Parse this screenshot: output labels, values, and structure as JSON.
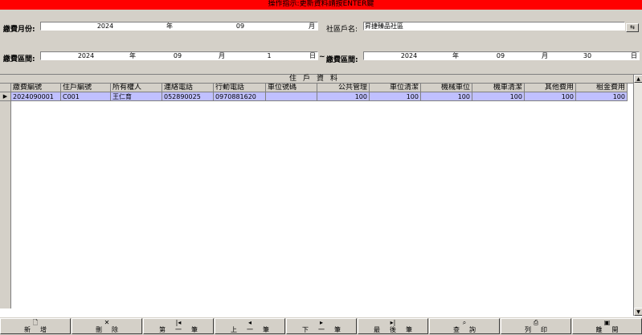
{
  "banner": "操作指示:更新資料請按ENTER鍵",
  "header": {
    "month_label": "繳費月份:",
    "month": {
      "year": "2024",
      "year_unit": "年",
      "month": "09",
      "month_unit": "月"
    },
    "community_label": "社區戶名:",
    "community_value": "昇捷臻品社區",
    "range_label": "繳費區間:",
    "range_start": {
      "year": "2024",
      "year_unit": "年",
      "month": "09",
      "month_unit": "月",
      "day": "1",
      "day_unit": "日"
    },
    "range_sep": "~",
    "range_label2": "繳費區間:",
    "range_end": {
      "year": "2024",
      "year_unit": "年",
      "month": "09",
      "month_unit": "月",
      "day": "30",
      "day_unit": "日"
    }
  },
  "grid": {
    "title": "住戶資料",
    "columns": [
      "繳費編號",
      "住戶編號",
      "所有權人",
      "連絡電話",
      "行動電話",
      "車位號碼",
      "公共管理",
      "車位清潔",
      "機械車位",
      "機車清潔",
      "其他費用",
      "租金費用"
    ],
    "rows": [
      [
        "2024090001",
        "C001",
        "王仁育",
        "052890025",
        "0970881620",
        "",
        "100",
        "100",
        "100",
        "100",
        "100",
        "100"
      ]
    ],
    "current_row_marker": "▶"
  },
  "toolbar": {
    "buttons": [
      {
        "label": "新增",
        "icon": "new-doc-icon"
      },
      {
        "label": "刪除",
        "icon": "delete-x-icon"
      },
      {
        "label": "第一筆",
        "icon": "first-record-icon"
      },
      {
        "label": "上一筆",
        "icon": "prev-record-icon"
      },
      {
        "label": "下一筆",
        "icon": "next-record-icon"
      },
      {
        "label": "最後筆",
        "icon": "last-record-icon"
      },
      {
        "label": "查詢",
        "icon": "query-icon"
      },
      {
        "label": "列印",
        "icon": "printer-icon"
      },
      {
        "label": "離開",
        "icon": "save-exit-icon"
      }
    ]
  },
  "colors": {
    "banner": "#ff0000",
    "selected_row": "#c0c0ff",
    "face": "#d4d0c8"
  }
}
